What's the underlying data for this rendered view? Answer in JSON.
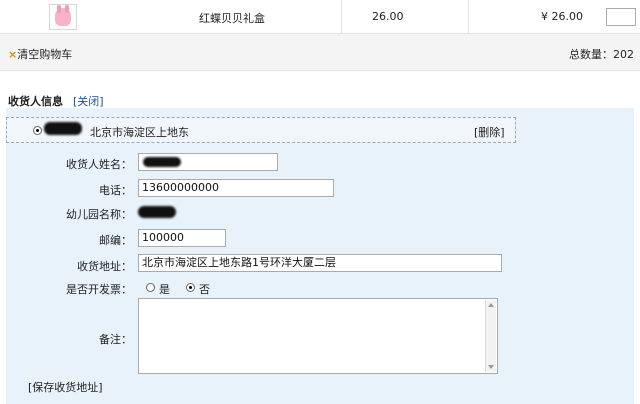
{
  "product": {
    "name": "红蝶贝贝礼盒",
    "price": "26.00",
    "total": "¥ 26.00"
  },
  "cart": {
    "clear_icon": "×",
    "clear_label": "清空购物车",
    "total_qty": "总数量：202"
  },
  "consignee": {
    "title": "收货人信息",
    "close_label": "[关闭]",
    "saved_address": "北京市海淀区上地东",
    "delete_label": "[删除]",
    "fields": {
      "name_label": "收货人姓名：",
      "phone_label": "电话：",
      "phone_value": "13600000000",
      "kindergarten_label": "幼儿园名称：",
      "zip_label": "邮编：",
      "zip_value": "100000",
      "address_label": "收货地址：",
      "address_value": "北京市海淀区上地东路1号环洋大厦二层",
      "invoice_label": "是否开发票：",
      "invoice_yes": "是",
      "invoice_no": "否",
      "invoice_selected": "否",
      "note_label": "备注："
    },
    "save_label": "[保存收货地址]"
  },
  "colors": {
    "accent_link": "#1b4f9c",
    "panel_bg": "#e8f2fa",
    "clear_icon": "#e28a1c"
  }
}
